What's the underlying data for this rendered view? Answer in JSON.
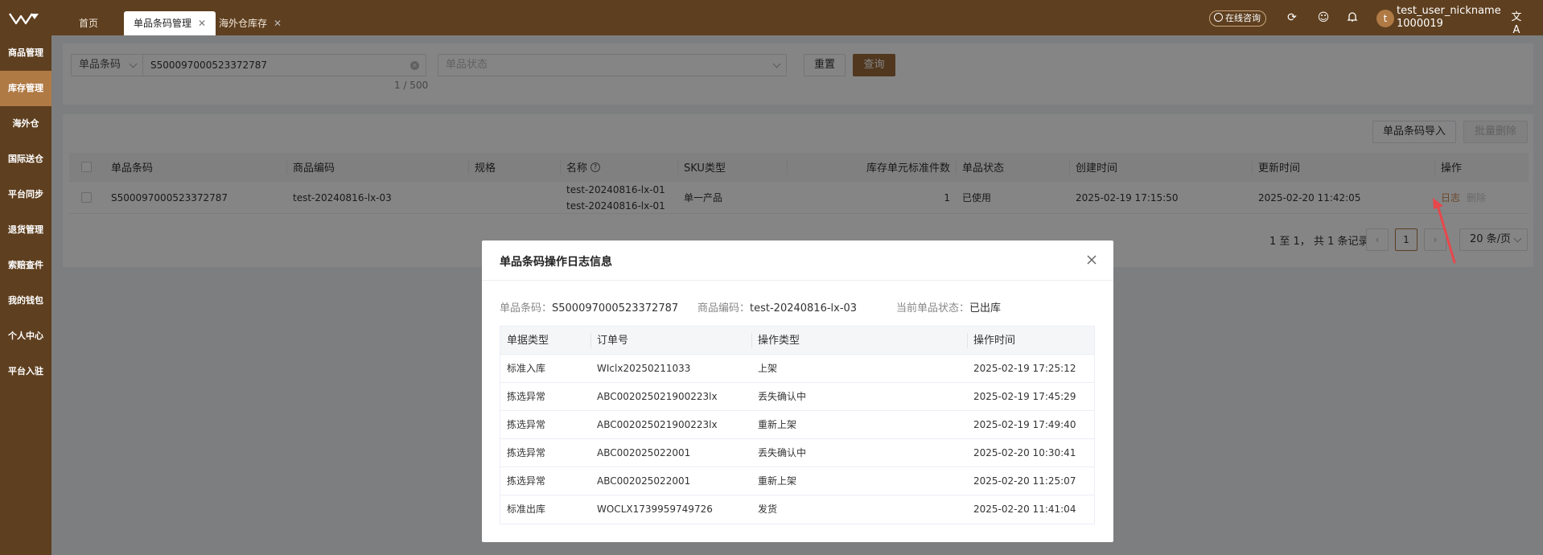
{
  "header": {
    "tabs": [
      {
        "label": "首页",
        "closable": false,
        "active": false
      },
      {
        "label": "单品条码管理",
        "closable": true,
        "active": true
      },
      {
        "label": "海外仓库存",
        "closable": true,
        "active": false
      }
    ],
    "consult_label": "在线咨询",
    "icons": [
      "refresh-icon",
      "smile-icon",
      "bell-icon",
      "translate-icon"
    ],
    "avatar_letter": "t",
    "user_name": "test_user_nickname",
    "user_id": "1000019"
  },
  "sidebar": {
    "items": [
      {
        "label": "商品管理",
        "active": false
      },
      {
        "label": "库存管理",
        "active": true
      },
      {
        "label": "海外仓",
        "active": false
      },
      {
        "label": "国际送仓",
        "active": false
      },
      {
        "label": "平台同步",
        "active": false
      },
      {
        "label": "退货管理",
        "active": false
      },
      {
        "label": "索赔查件",
        "active": false
      },
      {
        "label": "我的钱包",
        "active": false
      },
      {
        "label": "个人中心",
        "active": false
      },
      {
        "label": "平台入驻",
        "active": false
      }
    ]
  },
  "filter": {
    "type_select": "单品条码",
    "barcode_value": "S500097000523372787",
    "count": "1 / 500",
    "status_placeholder": "单品状态",
    "reset_label": "重置",
    "query_label": "查询"
  },
  "table": {
    "import_label": "单品条码导入",
    "batch_delete_label": "批量删除",
    "columns": [
      "单品条码",
      "商品编码",
      "规格",
      "名称",
      "SKU类型",
      "库存单元标准件数",
      "单品状态",
      "创建时间",
      "更新时间",
      "操作"
    ],
    "rows": [
      {
        "barcode": "S500097000523372787",
        "product_code": "test-20240816-lx-03",
        "spec": "",
        "name_line1": "test-20240816-lx-01",
        "name_line2": "test-20240816-lx-01",
        "sku_type": "单一产品",
        "std_qty": "1",
        "status": "已使用",
        "created": "2025-02-19 17:15:50",
        "updated": "2025-02-20 11:42:05",
        "action_log": "日志",
        "action_delete": "删除"
      }
    ],
    "pagination": {
      "summary": "1 至 1， 共 1 条记录",
      "current_page": "1",
      "page_size": "20 条/页"
    }
  },
  "modal": {
    "title": "单品条码操作日志信息",
    "barcode_label": "单品条码：",
    "barcode_value": "S500097000523372787",
    "product_code_label": "商品编码：",
    "product_code_value": "test-20240816-lx-03",
    "status_label": "当前单品状态：",
    "status_value": "已出库",
    "columns": [
      "单据类型",
      "订单号",
      "操作类型",
      "操作时间"
    ],
    "rows": [
      {
        "doc_type": "标准入库",
        "order_no": "WIclx20250211033",
        "op_type": "上架",
        "op_time": "2025-02-19 17:25:12"
      },
      {
        "doc_type": "拣选异常",
        "order_no": "ABC002025021900223lx",
        "op_type": "丢失确认中",
        "op_time": "2025-02-19 17:45:29"
      },
      {
        "doc_type": "拣选异常",
        "order_no": "ABC002025021900223lx",
        "op_type": "重新上架",
        "op_time": "2025-02-19 17:49:40"
      },
      {
        "doc_type": "拣选异常",
        "order_no": "ABC002025022001",
        "op_type": "丢失确认中",
        "op_time": "2025-02-20 10:30:41"
      },
      {
        "doc_type": "拣选异常",
        "order_no": "ABC002025022001",
        "op_type": "重新上架",
        "op_time": "2025-02-20 11:25:07"
      },
      {
        "doc_type": "标准出库",
        "order_no": "WOCLX1739959749726",
        "op_type": "发货",
        "op_time": "2025-02-20 11:41:04"
      }
    ]
  },
  "colors": {
    "brand_dark": "#5e3f1f",
    "brand_accent": "#b07a45",
    "annotation_arrow": "#e8474b"
  }
}
